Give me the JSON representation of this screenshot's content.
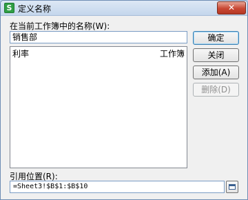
{
  "window": {
    "title": "定义名称",
    "app_icon_glyph": "S",
    "close_glyph": "✕"
  },
  "name_section": {
    "label": "在当前工作簿中的名称(W):",
    "value": "销售部"
  },
  "list": {
    "columns": [
      "利率",
      "工作簿"
    ]
  },
  "buttons": {
    "ok": "确定",
    "close": "关闭",
    "add": "添加(A)",
    "delete": "删除(D)"
  },
  "reference": {
    "label": "引用位置(R):",
    "value": "=Sheet3!$B$1:$B$10"
  },
  "icons": {
    "app": "wps-spreadsheet-icon",
    "close": "close-icon",
    "collapse": "collapse-dialog-icon"
  }
}
